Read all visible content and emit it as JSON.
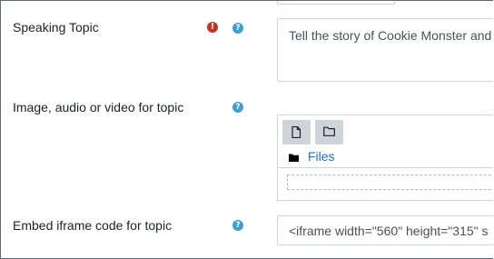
{
  "fields": {
    "speaking_topic": {
      "label": "Speaking Topic",
      "required_icon": "exclamation-circle-icon",
      "help_icon": "question-circle-icon",
      "value": "Tell the story of Cookie Monster and"
    },
    "media": {
      "label": "Image, audio or video for topic",
      "help_icon": "question-circle-icon",
      "toolbar": [
        {
          "name": "add-file",
          "icon": "file-icon"
        },
        {
          "name": "create-folder",
          "icon": "folder-outline-icon"
        }
      ],
      "files_link": "Files"
    },
    "embed": {
      "label": "Embed iframe code for topic",
      "help_icon": "question-circle-icon",
      "value": "<iframe width=\"560\" height=\"315\" s"
    }
  },
  "colors": {
    "required": "#ca3120",
    "help": "#3e9fd2",
    "link": "#1f6fbf",
    "border": "#ced4da"
  }
}
